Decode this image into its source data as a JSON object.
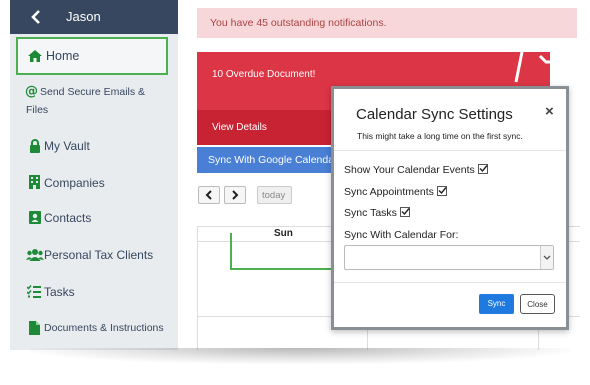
{
  "sidebar": {
    "user_name": "Jason",
    "items": [
      {
        "label": "Home",
        "icon": "home-icon"
      },
      {
        "label": "Send Secure Emails &",
        "label2": "Files",
        "icon": "at-icon"
      },
      {
        "label": "My Vault",
        "icon": "lock-icon"
      },
      {
        "label": "Companies",
        "icon": "building-icon"
      },
      {
        "label": "Contacts",
        "icon": "contact-card-icon"
      },
      {
        "label": "Personal Tax Clients",
        "icon": "users-icon"
      },
      {
        "label": "Tasks",
        "icon": "task-list-icon"
      },
      {
        "label": "Documents & Instructions",
        "icon": "document-icon"
      }
    ]
  },
  "main": {
    "alert_text": "You have 45 outstanding notifications.",
    "overdue": {
      "title": "10 Overdue Document!",
      "details": "View Details"
    },
    "sync_google_button": "Sync With Google Calendar",
    "calendar": {
      "today_label": "today",
      "day_header": "Sun"
    }
  },
  "modal": {
    "title": "Calendar Sync Settings",
    "subtitle": "This might take a long time on the first sync.",
    "options": [
      {
        "label": "Show Your Calendar Events",
        "checked": true
      },
      {
        "label": "Sync Appointments",
        "checked": true
      },
      {
        "label": "Sync Tasks",
        "checked": true
      }
    ],
    "sync_with_label": "Sync With Calendar For:",
    "select_value": "",
    "sync_button": "Sync",
    "close_button": "Close",
    "close_icon": "×"
  },
  "colors": {
    "sidebar_header": "#37475f",
    "sidebar_bg": "#e9ecef",
    "highlight_border": "#4caf50",
    "alert_bg": "#f8d7da",
    "overdue_bg": "#dc3545",
    "primary_button": "#1f7ae0"
  }
}
